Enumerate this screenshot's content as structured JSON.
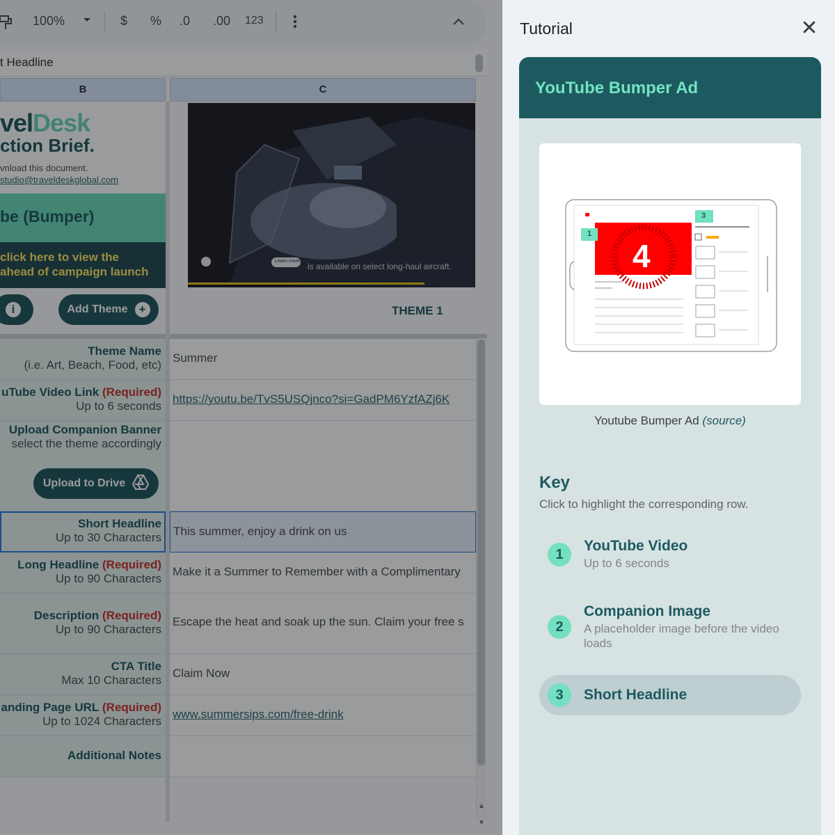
{
  "toolbar": {
    "zoom": "100%",
    "currency": "$",
    "percent": "%",
    "decrease_decimal": ".0",
    "increase_decimal": ".00",
    "number_format": "123"
  },
  "formula_bar": {
    "text": "t Headline"
  },
  "columns": {
    "b": "B",
    "c": "C"
  },
  "brief": {
    "logo_part1": "vel",
    "logo_part2": "Desk",
    "subtitle": "ction Brief.",
    "note": "vnload this document.",
    "email": "studio@traveldeskglobal.com",
    "bumper": "be (Bumper)",
    "click_line1": "click here to view the",
    "click_line2": "ahead of campaign launch",
    "add_theme": "Add Theme",
    "theme_header": "THEME 1"
  },
  "video": {
    "overlay_text": "is available on select long-haul aircraft.",
    "learn_more": "Learn more"
  },
  "rows": [
    {
      "label": "Theme Name",
      "required": "",
      "sub": "(i.e. Art, Beach, Food, etc)",
      "value": "Summer",
      "link": false
    },
    {
      "label": "uTube Video Link",
      "required": "(Required)",
      "sub": "Up to 6 seconds",
      "value": "https://youtu.be/TvS5USQjnco?si=GadPM6YzfAZj6K",
      "link": true
    },
    {
      "label": "Upload Companion Banner",
      "required": "",
      "sub": "select the theme accordingly",
      "value": "",
      "link": false,
      "button": "Upload to Drive"
    },
    {
      "label": "Short Headline",
      "required": "",
      "sub": "Up to 30 Characters",
      "value": "This summer, enjoy a drink on us",
      "link": false
    },
    {
      "label": "Long Headline",
      "required": "(Required)",
      "sub": "Up to 90 Characters",
      "value": "Make it a Summer to Remember with a Complimentary",
      "link": false
    },
    {
      "label": "Description",
      "required": "(Required)",
      "sub": "Up to 90 Characters",
      "value": "Escape the heat and soak up the sun. Claim your free s",
      "link": false
    },
    {
      "label": "CTA Title",
      "required": "",
      "sub": "Max 10 Characters",
      "value": "Claim Now",
      "link": false
    },
    {
      "label": "anding Page URL",
      "required": "(Required)",
      "sub": "Up to 1024 Characters",
      "value": "www.summersips.com/free-drink",
      "link": true
    },
    {
      "label": "Additional Notes",
      "required": "",
      "sub": "",
      "value": "",
      "link": false
    }
  ],
  "tutorial": {
    "title": "Tutorial",
    "card_title": "YouTube Bumper Ad",
    "preview_countdown": "4",
    "preview_badge_1": "1",
    "preview_badge_3": "3",
    "caption": "Youtube Bumper Ad",
    "caption_source": "(source)",
    "key_title": "Key",
    "key_desc": "Click to highlight the corresponding row.",
    "key_items": [
      {
        "num": "1",
        "name": "YouTube Video",
        "sub": "Up to 6 seconds"
      },
      {
        "num": "2",
        "name": "Companion Image",
        "sub": "A placeholder image before the video loads"
      },
      {
        "num": "3",
        "name": "Short Headline",
        "sub": ""
      }
    ]
  },
  "colors": {
    "brand_dark": "#0f4c52",
    "brand_mint": "#5fd8b4",
    "card_header": "#1d5a60",
    "required_red": "#c5221f",
    "key_badge": "#73e0c0"
  }
}
